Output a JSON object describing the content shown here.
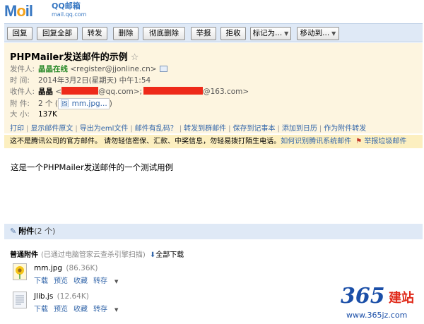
{
  "logo": {
    "text": "M",
    "dot": "o",
    "rest": "il",
    "sub1": "QQ邮箱",
    "sub2": "mail.qq.com"
  },
  "toolbar": {
    "reply": "回复",
    "reply_all": "回复全部",
    "forward": "转发",
    "delete": "删除",
    "delete_permanent": "彻底删除",
    "report": "举报",
    "reject": "拒收",
    "mark_as": "标记为...",
    "move_to": "移动到..."
  },
  "header": {
    "subject": "PHPMailer发送邮件的示例",
    "star": "☆",
    "from_label": "发件人:",
    "from_name": "晶晶在线",
    "from_addr": "<register@jjonline.cn>",
    "time_label": "时  间:",
    "time_value": "2014年3月2日(星期天) 中午1:54",
    "to_label": "收件人:",
    "to_name": "晶晶",
    "to_addr1_prefix": "<",
    "to_addr1_suffix": "@qq.com>;",
    "to_addr2_suffix": "@163.com>",
    "attach_label": "附  件:",
    "attach_value": "2 个 (",
    "attach_chip": "mm.jpg...",
    "attach_close": ")",
    "size_label": "大  小:",
    "size_value": "137K"
  },
  "actions": [
    "打印",
    "显示邮件原文",
    "导出为eml文件",
    "邮件有乱码？",
    "转发到群邮件",
    "保存到记事本",
    "添加到日历",
    "作为附件转发"
  ],
  "notice": {
    "text": "这不是腾讯公司的官方邮件。 请勿轻信密保、汇款、中奖信息，勿轻易拨打陌生电话。",
    "link": "如何识别腾讯系统邮件",
    "report": "举报垃圾邮件"
  },
  "body": {
    "text": "这是一个PHPMailer发送邮件的一个测试用例"
  },
  "attachments": {
    "title": "附件",
    "count": "(2 个)",
    "group_label": "普通附件",
    "scan_text": "(已通过电脑管家云查杀引擎扫描)",
    "download_all": "全部下载",
    "files": [
      {
        "name": "mm.jpg",
        "size": "(86.36K)",
        "actions": [
          "下载",
          "预览",
          "收藏",
          "转存"
        ]
      },
      {
        "name": "Jlib.js",
        "size": "(12.64K)",
        "actions": [
          "下载",
          "预览",
          "收藏",
          "转存"
        ]
      }
    ]
  },
  "watermark": {
    "num": "365",
    "cn": "建站",
    "url": "www.365jz.com"
  },
  "colors": {
    "accent": "#3366aa",
    "header_bg": "#fdf5e0",
    "notice_bg": "#fcefc0",
    "toolbar_bg": "#dfe9f6",
    "redaction": "#ee2a1a"
  }
}
